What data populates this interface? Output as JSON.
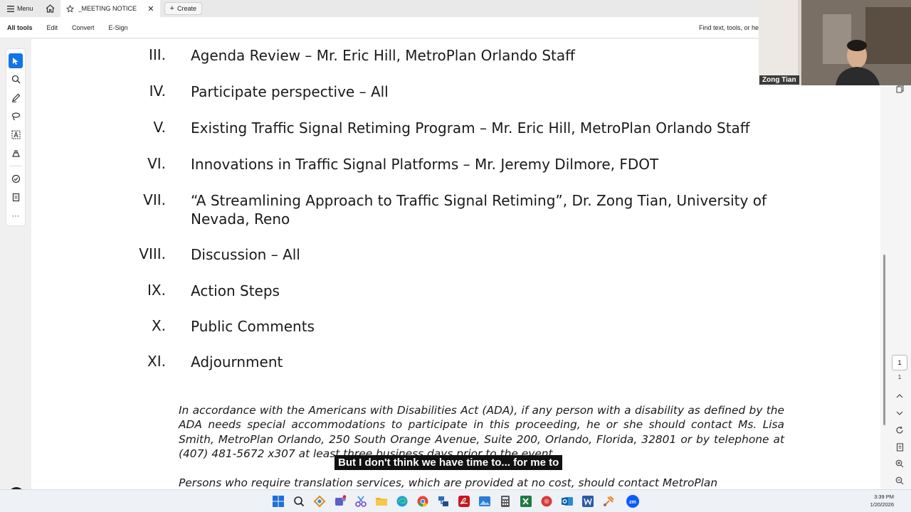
{
  "titlebar": {
    "menu_label": "Menu",
    "tab_title": "_MEETING NOTICE",
    "create_label": "Create"
  },
  "toolbar": {
    "items": [
      "All tools",
      "Edit",
      "Convert",
      "E-Sign"
    ],
    "find_placeholder": "Find text, tools, or he"
  },
  "webcam": {
    "participant_name": "Zong Tian"
  },
  "document": {
    "agenda": [
      {
        "num": "III.",
        "text": "Agenda Review – Mr. Eric Hill, MetroPlan Orlando Staff"
      },
      {
        "num": "IV.",
        "text": "Participate perspective – All"
      },
      {
        "num": "V.",
        "text": "Existing Traffic Signal Retiming Program – Mr. Eric Hill, MetroPlan Orlando Staff"
      },
      {
        "num": "VI.",
        "text": "Innovations in Traffic Signal Platforms – Mr. Jeremy Dilmore, FDOT"
      },
      {
        "num": "VII.",
        "text": "“A Streamlining Approach to Traffic Signal Retiming”, Dr. Zong Tian, University of Nevada, Reno"
      },
      {
        "num": "VIII.",
        "text": "Discussion – All"
      },
      {
        "num": "IX.",
        "text": "Action Steps"
      },
      {
        "num": "X.",
        "text": "Public Comments"
      },
      {
        "num": "XI.",
        "text": "Adjournment"
      }
    ],
    "ada_paragraph": "In accordance with the Americans with Disabilities Act (ADA), if any person with a disability as defined by the ADA needs special accommodations to participate in this proceeding, he or she should contact Ms. Lisa Smith, MetroPlan Orlando, 250 South Orange Avenue, Suite 200, Orlando, Florida, 32801 or by telephone at (407) 481-5672 x307 at least three business days prior to the event.",
    "translation_paragraph": "Persons who require translation services, which are provided at no cost, should contact MetroPlan"
  },
  "page_nav": {
    "current_page": "1",
    "total_pages": "1"
  },
  "caption": {
    "text": "But I don't think we have time to... for me to"
  },
  "taskbar": {
    "time": "3:39 PM",
    "date": "1/20/2026"
  },
  "colors": {
    "accent": "#1473e6"
  }
}
